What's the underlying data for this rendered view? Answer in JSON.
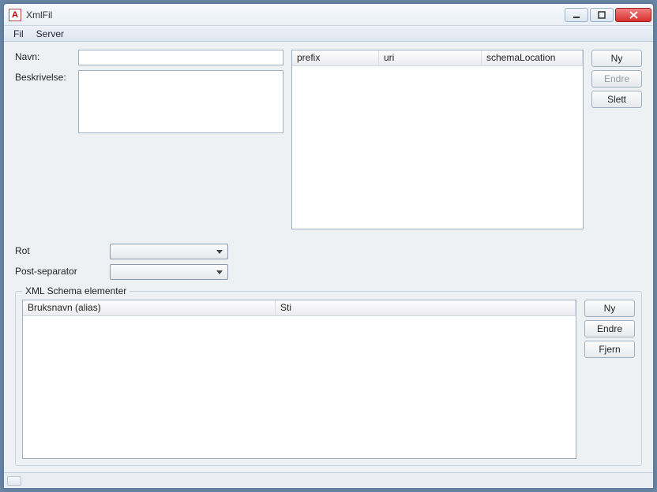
{
  "window": {
    "title": "XmlFil",
    "app_icon_letter": "A"
  },
  "menubar": {
    "fil": "Fil",
    "server": "Server"
  },
  "form": {
    "navn_label": "Navn:",
    "navn_value": "",
    "beskrivelse_label": "Beskrivelse:",
    "beskrivelse_value": ""
  },
  "prefix_table": {
    "columns": {
      "prefix": "prefix",
      "uri": "uri",
      "schemaLocation": "schemaLocation"
    },
    "rows": []
  },
  "prefix_buttons": {
    "ny": "Ny",
    "endre": "Endre",
    "slett": "Slett"
  },
  "mid": {
    "rot_label": "Rot",
    "rot_value": "",
    "post_separator_label": "Post-separator",
    "post_separator_value": ""
  },
  "groupbox": {
    "title": "XML Schema elementer"
  },
  "schema_table": {
    "columns": {
      "alias": "Bruksnavn (alias)",
      "sti": "Sti"
    },
    "rows": []
  },
  "schema_buttons": {
    "ny": "Ny",
    "endre": "Endre",
    "fjern": "Fjern"
  }
}
